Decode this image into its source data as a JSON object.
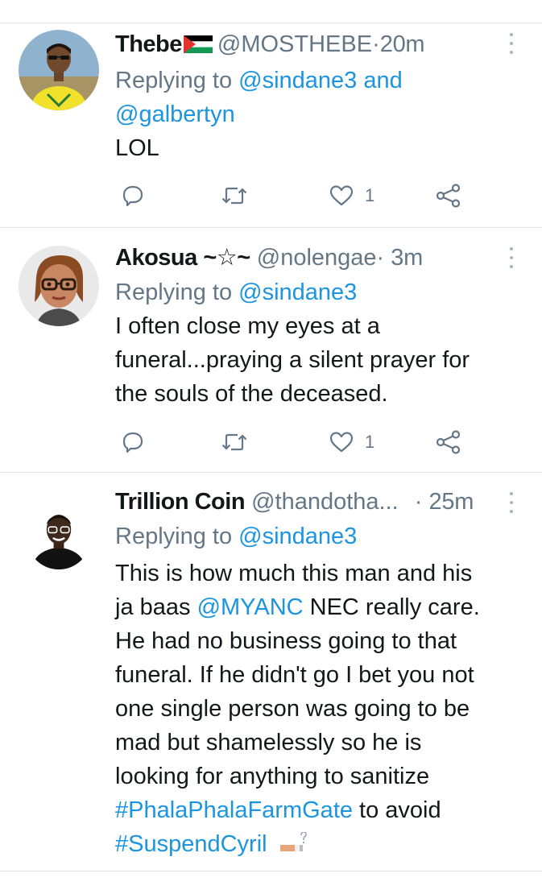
{
  "tweets": [
    {
      "name": "Thebe",
      "handle": "@MOSTHEBE",
      "dot": "·",
      "time": "20m",
      "reply_prefix": "Replying to",
      "reply_to_1": "@sindane3",
      "reply_and": "and",
      "reply_to_2": "@galbertyn",
      "text": "LOL",
      "like_count": "1",
      "icons": [
        "reply-icon",
        "retweet-icon",
        "heart-icon",
        "share-icon",
        "more-vertical-icon",
        "palestine-flag-icon"
      ]
    },
    {
      "name": "Akosua ~☆~",
      "handle": "@nolengae",
      "dot": "·",
      "time": "3m",
      "reply_prefix": "Replying to",
      "reply_to_1": "@sindane3",
      "text": "I often close my eyes at a funeral...praying a silent prayer for the souls of the deceased.",
      "text_lines": [
        "I often close my eyes at a",
        "funeral...praying a silent prayer for",
        "the souls of the deceased."
      ],
      "like_count": "1"
    },
    {
      "name": "Trillion Coin",
      "handle": "@thandotha...",
      "dot": "·",
      "time": "25m",
      "reply_prefix": "Replying to",
      "reply_to_1": "@sindane3",
      "text_parts": {
        "l1": "This is how much this man and his",
        "l2a": "ja baas ",
        "l2_mention": "@MYANC",
        "l2b": " NEC really care.",
        "l3": "He had no business going to that",
        "l4": "funeral. If he didn't go I bet you not",
        "l5": "one single person was going to be",
        "l6": "mad but shamelessly so he is",
        "l7": "looking for anything to sanitize",
        "l8_tag": "#PhalaPhalaFarmGate",
        "l8b": " to avoid",
        "l9_tag": "#SuspendCyril"
      }
    }
  ],
  "colors": {
    "link": "#1b95e0",
    "secondary_text": "#657786",
    "primary_text": "#14171a",
    "divider": "#dfe3e6"
  }
}
